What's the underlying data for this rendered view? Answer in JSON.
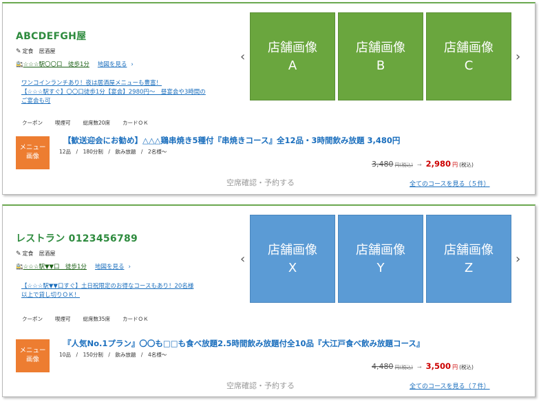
{
  "shops": [
    {
      "name": "ABCDEFGH屋",
      "genre": "定食　居酒屋",
      "access_station": "☆☆☆駅〇〇口　徒歩1分",
      "map_label": "地図を見る",
      "catch_lines": [
        "ワンコインランチあり！夜は居酒屋メニューも豊富！",
        "【☆☆☆駅すぐ】〇〇口徒歩1分【宴会】2980円～　昼宴会や3時間の",
        "ご宴会も可"
      ],
      "tags": [
        "クーポン",
        "喫煙可",
        "総席数20席",
        "カードＯＫ"
      ],
      "images": [
        "店舗画像\nA",
        "店舗画像\nB",
        "店舗画像\nC"
      ],
      "menu_image_label": "メニュー\n画像",
      "course_title": "【歓送迎会にお勧め】△△△鶏串焼き5種付『串焼きコース』全12品・3時間飲み放題 3,480円",
      "course_detail": "12品　/　180分制　/　飲み放題　/　2名様～",
      "old_price": "3,480",
      "old_price_unit": "円(税込)",
      "new_price": "2,980",
      "new_price_unit": "円",
      "tax_label": "(税込)",
      "reserve_label": "空席確認・予約する",
      "all_courses_label": "全てのコースを見る（５件）"
    },
    {
      "name": "レストラン 0123456789",
      "genre": "定食　居酒屋",
      "access_station": "☆☆☆駅▼▼口　徒歩1分",
      "map_label": "地図を見る",
      "catch_lines": [
        "【☆☆☆駅▼▼口すぐ】土日祝限定のお得なコースもあり！20名様",
        "以上で貸し切りＯＫ！"
      ],
      "tags": [
        "クーポン",
        "喫煙可",
        "総席数35席",
        "カードＯＫ"
      ],
      "images": [
        "店舗画像\nX",
        "店舗画像\nY",
        "店舗画像\nZ"
      ],
      "menu_image_label": "メニュー\n画像",
      "course_title": "『人気No.1プラン』〇〇も□□も食べ放題2.5時間飲み放題付全10品『大江戸食べ飲み放題コース』",
      "course_detail": "10品　/　150分制　/　飲み放題　/　4名様～",
      "old_price": "4,480",
      "old_price_unit": "円(税込)",
      "new_price": "3,500",
      "new_price_unit": "円",
      "tax_label": "(税込)",
      "reserve_label": "空席確認・予約する",
      "all_courses_label": "全てのコースを見る（７件）"
    }
  ],
  "icons": {
    "genre": "pin-icon",
    "access": "train-icon",
    "prev": "chevron-left-icon",
    "next": "chevron-right-icon",
    "map_chevron": "chevron-right-icon"
  },
  "colors": {
    "accent_green": "#6aa63e",
    "accent_blue": "#5b9bd5",
    "link_blue": "#1a6ebd",
    "price_red": "#cc0000",
    "menu_orange": "#ed7d31"
  }
}
